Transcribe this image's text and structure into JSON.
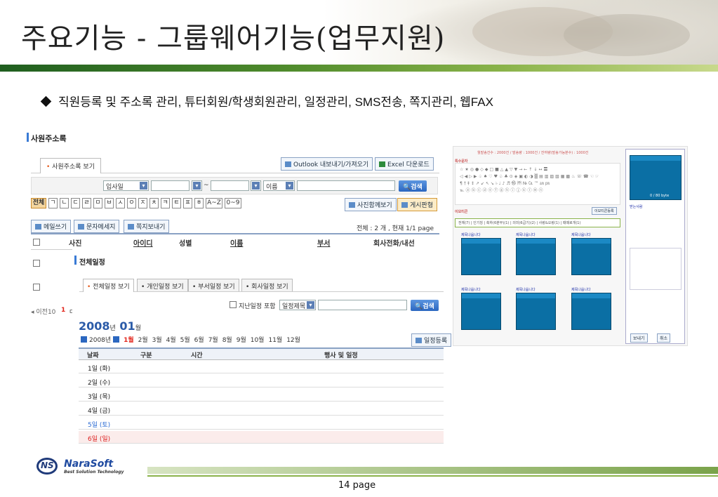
{
  "slide": {
    "title": "주요기능 - 그룹웨어기능(업무지원)",
    "bullet": "직원등록 및 주소록 관리, 튜터회원/학생회원관리, 일정관리, SMS전송, 쪽지관리, 웹FAX",
    "page": "14 page"
  },
  "address_book": {
    "section_title": "사원주소록",
    "tab": "사원주소록 보기",
    "outlook_button": "Outlook 내보내기/가져오기",
    "excel_button": "Excel 다운로드",
    "date_select": "입사일",
    "tilde": "~",
    "name_select": "이름",
    "search_button": "검색",
    "consonants": [
      "전체",
      "ㄱ",
      "ㄴ",
      "ㄷ",
      "ㄹ",
      "ㅁ",
      "ㅂ",
      "ㅅ",
      "ㅇ",
      "ㅈ",
      "ㅊ",
      "ㅋ",
      "ㅌ",
      "ㅍ",
      "ㅎ",
      "A~Z",
      "0~9"
    ],
    "photo_view_button": "사진함께보기",
    "board_view_button": "게시판형",
    "mail_button": "메일쓰기",
    "sms_button": "문자메세지",
    "note_button": "쪽지보내기",
    "count_text": "전체 : 2 개 , 현재 1/1 page",
    "columns": [
      "사진",
      "아이디",
      "성별",
      "이름",
      "부서",
      "회사전화/내선"
    ],
    "prev_text": "◂ 이전10",
    "page_num": "1",
    "row_stub": "ㄷ"
  },
  "schedule": {
    "section_title": "전체일정",
    "tabs": [
      "전체일정 보기",
      "개인일정 보기",
      "부서일정 보기",
      "회사일정 보기"
    ],
    "past_checkbox": "지난일정 포함",
    "filter_select": "일정제목",
    "search_button": "검색",
    "year": "2008",
    "year_unit": "년",
    "month": "01",
    "month_unit": "월",
    "year_nav": "2008년",
    "months": [
      "1월",
      "2월",
      "3월",
      "4월",
      "5월",
      "6월",
      "7월",
      "8월",
      "9월",
      "10월",
      "11월",
      "12월"
    ],
    "current_month": "1월",
    "register_button": "일정등록",
    "columns": [
      "날짜",
      "구분",
      "시간",
      "행사 및 일정"
    ],
    "rows": [
      "1일 (화)",
      "2일 (수)",
      "3일 (목)",
      "4일 (금)",
      "5일 (토)",
      "6일 (일)"
    ]
  },
  "sms": {
    "summary": "월발송건수 : 2000건 / 발송량 : 1000건 / 잔여량(발송가능분수) : 1000건",
    "special_char_label": "특수문자",
    "emoticon_label": "이모티콘",
    "emoticon_button": "이모티콘등록",
    "categories": "전체(7) | 인기칭 | 축하(6분부)(1) | 의미(6급기)(2) | 사랑&오랑(1) | 때때로개(1)",
    "message_titles": [
      "제목나옵니다",
      "제목나옵니다",
      "제목나옵니다",
      "제목나옵니다",
      "제목나옵니다",
      "제목나옵니다"
    ],
    "byte_counter": "0 / 80 byte",
    "phone_book": "받는사람",
    "send_button": "보내기",
    "cancel_button": "취소"
  },
  "logo": {
    "name": "NaraSoft",
    "tagline": "Best Solution Technology"
  },
  "colors": {
    "accent_blue": "#2b67c0",
    "green_bar": "#4f8b2c",
    "red": "#e2261c"
  }
}
